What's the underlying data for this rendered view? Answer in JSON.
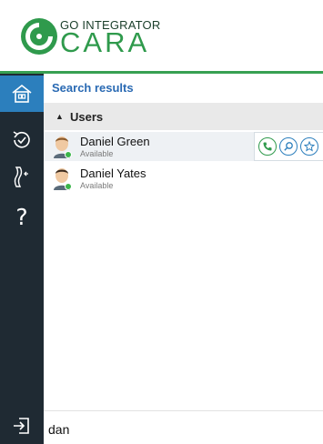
{
  "header": {
    "brand_small": "GO INTEGRATOR",
    "brand_big": "CARA",
    "brand_color": "#2f9a4c"
  },
  "sidebar": {
    "items": [
      {
        "icon": "home-icon",
        "active": true
      },
      {
        "icon": "history-icon",
        "active": false
      },
      {
        "icon": "settings-icon",
        "active": false
      },
      {
        "icon": "help-icon",
        "label": "?",
        "active": false
      }
    ],
    "logout_icon": "logout-icon",
    "active_color": "#2c7fbd",
    "bg_color": "#1f2a33"
  },
  "search_results": {
    "title": "Search results",
    "group": {
      "label": "Users",
      "expanded": true
    },
    "contacts": [
      {
        "name": "Daniel Green",
        "status": "Available",
        "status_color": "#3bb54a",
        "actions": [
          "phone-icon",
          "search-icon",
          "star-icon"
        ]
      },
      {
        "name": "Daniel Yates",
        "status": "Available",
        "status_color": "#3bb54a"
      }
    ]
  },
  "search": {
    "value": "dan"
  }
}
